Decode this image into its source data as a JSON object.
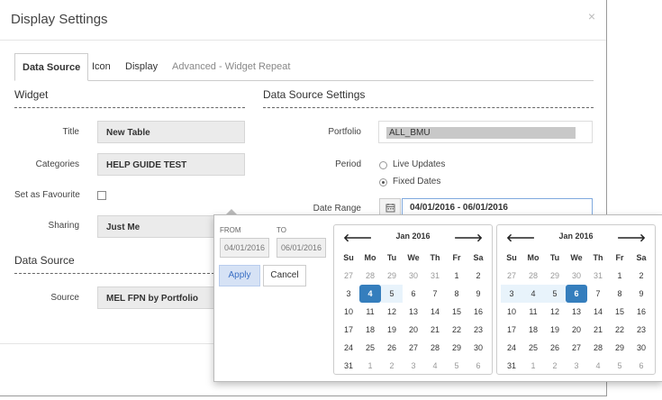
{
  "modal": {
    "title": "Display Settings",
    "close": "×"
  },
  "tabs": [
    "Data Source",
    "Icon",
    "Display",
    "Advanced - Widget Repeat"
  ],
  "widget": {
    "section_title": "Widget",
    "title_label": "Title",
    "title_value": "New Table",
    "categories_label": "Categories",
    "categories_value": "HELP GUIDE TEST",
    "favourite_label": "Set as Favourite",
    "sharing_label": "Sharing",
    "sharing_value": "Just Me"
  },
  "data_source": {
    "section_title": "Data Source",
    "source_label": "Source",
    "source_value": "MEL FPN by Portfolio"
  },
  "ds_settings": {
    "section_title": "Data Source Settings",
    "portfolio_label": "Portfolio",
    "portfolio_value": "ALL_BMU",
    "period_label": "Period",
    "period_options": [
      "Live Updates",
      "Fixed Dates"
    ],
    "period_selected": "Fixed Dates",
    "date_range_label": "Date Range",
    "date_range_value": "04/01/2016 - 06/01/2016"
  },
  "picker": {
    "from_label": "FROM",
    "from_value": "04/01/2016",
    "to_label": "TO",
    "to_value": "06/01/2016",
    "apply": "Apply",
    "cancel": "Cancel",
    "weekdays": [
      "Su",
      "Mo",
      "Tu",
      "We",
      "Th",
      "Fr",
      "Sa"
    ],
    "left_cal": {
      "month": "Jan 2016",
      "prev": "🡐",
      "next": "🡒",
      "weeks": [
        [
          "27",
          "28",
          "29",
          "30",
          "31",
          "1",
          "2"
        ],
        [
          "3",
          "4",
          "5",
          "6",
          "7",
          "8",
          "9"
        ],
        [
          "10",
          "11",
          "12",
          "13",
          "14",
          "15",
          "16"
        ],
        [
          "17",
          "18",
          "19",
          "20",
          "21",
          "22",
          "23"
        ],
        [
          "24",
          "25",
          "26",
          "27",
          "28",
          "29",
          "30"
        ],
        [
          "31",
          "1",
          "2",
          "3",
          "4",
          "5",
          "6"
        ]
      ]
    },
    "right_cal": {
      "month": "Jan 2016",
      "prev": "🡐",
      "next": "🡒",
      "weeks": [
        [
          "27",
          "28",
          "29",
          "30",
          "31",
          "1",
          "2"
        ],
        [
          "3",
          "4",
          "5",
          "6",
          "7",
          "8",
          "9"
        ],
        [
          "10",
          "11",
          "12",
          "13",
          "14",
          "15",
          "16"
        ],
        [
          "17",
          "18",
          "19",
          "20",
          "21",
          "22",
          "23"
        ],
        [
          "24",
          "25",
          "26",
          "27",
          "28",
          "29",
          "30"
        ],
        [
          "31",
          "1",
          "2",
          "3",
          "4",
          "5",
          "6"
        ]
      ]
    },
    "selected_start": "4",
    "selected_end": "6"
  }
}
